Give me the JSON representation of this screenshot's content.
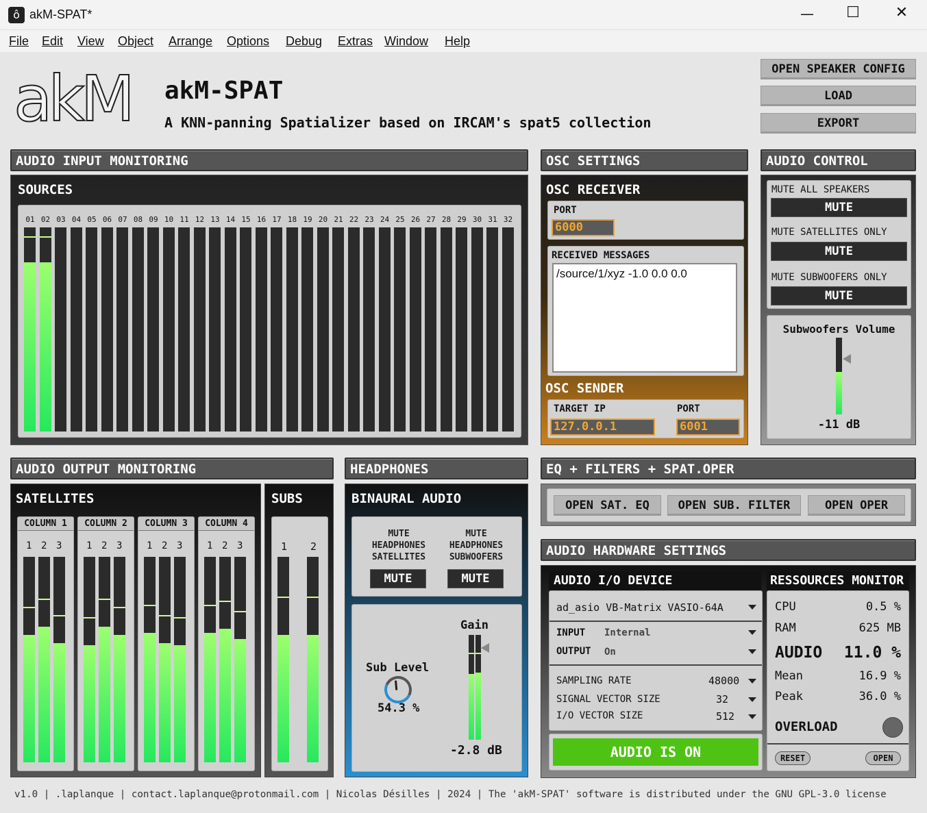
{
  "window": {
    "title": "akM-SPAT*",
    "app_icon": "max-logo-icon"
  },
  "menu": [
    "File",
    "Edit",
    "View",
    "Object",
    "Arrange",
    "Options",
    "Debug",
    "Extras",
    "Window",
    "Help"
  ],
  "header": {
    "logo_text": "akM",
    "title": "akM-SPAT",
    "subtitle": "A KNN-panning Spatializer based on IRCAM's spat5 collection",
    "buttons": [
      "OPEN SPEAKER CONFIG",
      "LOAD",
      "EXPORT"
    ]
  },
  "input": {
    "section": "AUDIO INPUT MONITORING",
    "title": "SOURCES",
    "channels": [
      "01",
      "02",
      "03",
      "04",
      "05",
      "06",
      "07",
      "08",
      "09",
      "10",
      "11",
      "12",
      "13",
      "14",
      "15",
      "16",
      "17",
      "18",
      "19",
      "20",
      "21",
      "22",
      "23",
      "24",
      "25",
      "26",
      "27",
      "28",
      "29",
      "30",
      "31",
      "32"
    ],
    "levels": [
      0.83,
      0.83,
      0,
      0,
      0,
      0,
      0,
      0,
      0,
      0,
      0,
      0,
      0,
      0,
      0,
      0,
      0,
      0,
      0,
      0,
      0,
      0,
      0,
      0,
      0,
      0,
      0,
      0,
      0,
      0,
      0,
      0
    ]
  },
  "osc": {
    "section": "OSC SETTINGS",
    "receiver": "OSC RECEIVER",
    "port_label": "PORT",
    "port": "6000",
    "messages_label": "RECEIVED MESSAGES",
    "message": "/source/1/xyz -1.0 0.0 0.0",
    "sender": "OSC SENDER",
    "ip_label": "TARGET IP",
    "ip": "127.0.0.1",
    "sender_port_label": "PORT",
    "sender_port": "6001"
  },
  "control": {
    "section": "AUDIO CONTROL",
    "mute_all": "MUTE ALL SPEAKERS",
    "mute_sat": "MUTE SATELLITES ONLY",
    "mute_sub": "MUTE SUBWOOFERS ONLY",
    "mute": "MUTE",
    "sub_volume_label": "Subwoofers Volume",
    "sub_volume": "-11 dB",
    "sub_level": 0.55
  },
  "output": {
    "section": "AUDIO OUTPUT MONITORING",
    "satellites": "SATELLITES",
    "subs": "SUBS",
    "columns": [
      {
        "label": "COLUMN 1",
        "nums": [
          "1",
          "2",
          "3"
        ],
        "levels": [
          0.62,
          0.66,
          0.58
        ]
      },
      {
        "label": "COLUMN 2",
        "nums": [
          "1",
          "2",
          "3"
        ],
        "levels": [
          0.57,
          0.66,
          0.62
        ]
      },
      {
        "label": "COLUMN 3",
        "nums": [
          "1",
          "2",
          "3"
        ],
        "levels": [
          0.63,
          0.58,
          0.57
        ]
      },
      {
        "label": "COLUMN 4",
        "nums": [
          "1",
          "2",
          "3"
        ],
        "levels": [
          0.63,
          0.65,
          0.6
        ]
      }
    ],
    "sub_nums": [
      "1",
      "2"
    ],
    "sub_levels": [
      0.62,
      0.62
    ]
  },
  "headphones": {
    "section": "HEADPHONES",
    "title": "BINAURAL AUDIO",
    "mute_sat": "MUTE HEADPHONES SATELLITES",
    "mute_sub": "MUTE HEADPHONES SUBWOOFERS",
    "mute": "MUTE",
    "sub_level_label": "Sub Level",
    "sub_level": "54.3 %",
    "gain_label": "Gain",
    "gain": "-2.8 dB",
    "gain_levels": [
      0.63,
      0.64
    ]
  },
  "eq": {
    "section": "EQ + FILTERS + SPAT.OPER",
    "buttons": [
      "OPEN SAT. EQ",
      "OPEN SUB. FILTER",
      "OPEN OPER"
    ]
  },
  "hardware": {
    "section": "AUDIO HARDWARE SETTINGS",
    "io_title": "AUDIO I/O DEVICE",
    "device": "ad_asio VB-Matrix VASIO-64A",
    "input_label": "INPUT",
    "input": "Internal",
    "output_label": "OUTPUT",
    "output": "On",
    "sr_label": "SAMPLING RATE",
    "sr": "48000",
    "svs_label": "SIGNAL VECTOR SIZE",
    "svs": "32",
    "iovs_label": "I/O VECTOR SIZE",
    "iovs": "512",
    "audio_on": "AUDIO IS ON",
    "monitor_title": "RESSOURCES MONITOR",
    "cpu_label": "CPU",
    "cpu": "0.5 %",
    "ram_label": "RAM",
    "ram": "625 MB",
    "audio_label": "AUDIO",
    "audio": "11.0 %",
    "mean_label": "Mean",
    "mean": "16.9 %",
    "peak_label": "Peak",
    "peak": "36.0 %",
    "overload_label": "OVERLOAD",
    "reset": "RESET",
    "open": "OPEN"
  },
  "footer": "v1.0 | .laplanque | contact.laplanque@protonmail.com | Nicolas Désilles | 2024 | The 'akM-SPAT' software is distributed under the GNU GPL-3.0 license",
  "colors": {
    "meter_green": "#27e85e",
    "osc_orange": "#e8a13a",
    "audio_on_green": "#4fc314",
    "headphones_blue": "#2a8fd0"
  }
}
